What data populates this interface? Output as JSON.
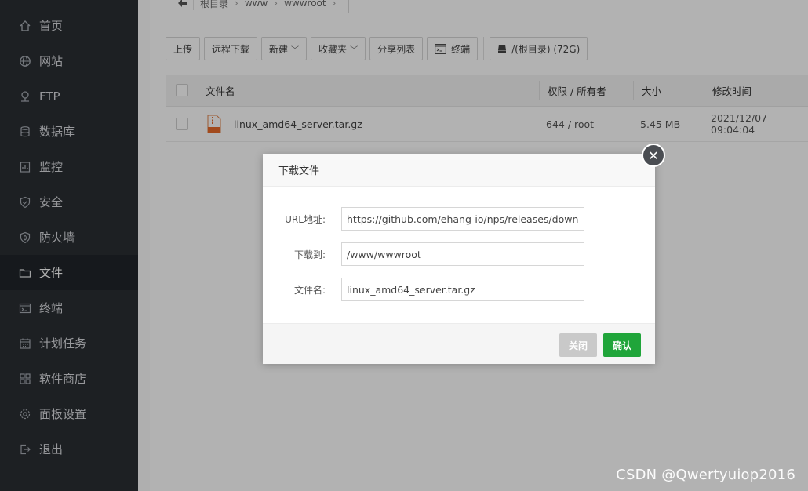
{
  "sidebar": {
    "items": [
      {
        "label": "首页",
        "icon": "home-icon"
      },
      {
        "label": "网站",
        "icon": "globe-icon"
      },
      {
        "label": "FTP",
        "icon": "ftp-icon"
      },
      {
        "label": "数据库",
        "icon": "database-icon"
      },
      {
        "label": "监控",
        "icon": "monitor-icon"
      },
      {
        "label": "安全",
        "icon": "shield-icon"
      },
      {
        "label": "防火墙",
        "icon": "firewall-icon"
      },
      {
        "label": "文件",
        "icon": "folder-icon",
        "active": true
      },
      {
        "label": "终端",
        "icon": "terminal-icon"
      },
      {
        "label": "计划任务",
        "icon": "calendar-icon"
      },
      {
        "label": "软件商店",
        "icon": "apps-grid-icon"
      },
      {
        "label": "面板设置",
        "icon": "gear-icon"
      },
      {
        "label": "退出",
        "icon": "logout-icon"
      }
    ]
  },
  "breadcrumb": [
    "根目录",
    "www",
    "wwwroot"
  ],
  "toolbar": {
    "upload": "上传",
    "remote_download": "远程下载",
    "new": "新建",
    "favorites": "收藏夹",
    "share_list": "分享列表",
    "terminal": "终端",
    "disk": "/(根目录) (72G)"
  },
  "table": {
    "headers": {
      "name": "文件名",
      "perm": "权限 / 所有者",
      "size": "大小",
      "mtime": "修改时间"
    },
    "rows": [
      {
        "name": "linux_amd64_server.tar.gz",
        "perm": "644 / root",
        "size": "5.45 MB",
        "mtime": "2021/12/07 09:04:04"
      }
    ]
  },
  "dialog": {
    "title": "下载文件",
    "url_label": "URL地址:",
    "url_value": "https://github.com/ehang-io/nps/releases/download",
    "dest_label": "下载到:",
    "dest_value": "/www/wwwroot",
    "filename_label": "文件名:",
    "filename_value": "linux_amd64_server.tar.gz",
    "close_button": "关闭",
    "confirm_button": "确认"
  },
  "colors": {
    "sidebar_bg": "#2a2e33",
    "accent_green": "#20a53a",
    "overlay": "rgba(0,0,0,0.3)"
  },
  "watermark": "CSDN @Qwertyuiop2016"
}
